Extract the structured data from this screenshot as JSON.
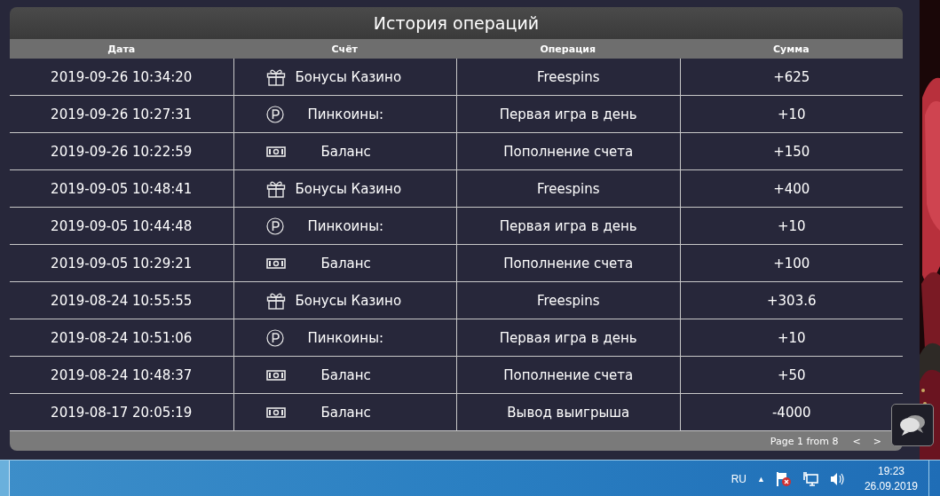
{
  "title": "История операций",
  "columns": [
    "Дата",
    "Счёт",
    "Операция",
    "Сумма"
  ],
  "rows": [
    {
      "date": "2019-09-26 10:34:20",
      "kind": "gift",
      "account": "Бонусы Казино",
      "operation": "Freespins",
      "amount": "+625"
    },
    {
      "date": "2019-09-26 10:27:31",
      "kind": "coin",
      "account": "Пинкоины:",
      "operation": "Первая игра в день",
      "amount": "+10"
    },
    {
      "date": "2019-09-26 10:22:59",
      "kind": "cash",
      "account": "Баланс",
      "operation": "Пополнение счета",
      "amount": "+150"
    },
    {
      "date": "2019-09-05 10:48:41",
      "kind": "gift",
      "account": "Бонусы Казино",
      "operation": "Freespins",
      "amount": "+400"
    },
    {
      "date": "2019-09-05 10:44:48",
      "kind": "coin",
      "account": "Пинкоины:",
      "operation": "Первая игра в день",
      "amount": "+10"
    },
    {
      "date": "2019-09-05 10:29:21",
      "kind": "cash",
      "account": "Баланс",
      "operation": "Пополнение счета",
      "amount": "+100"
    },
    {
      "date": "2019-08-24 10:55:55",
      "kind": "gift",
      "account": "Бонусы Казино",
      "operation": "Freespins",
      "amount": "+303.6"
    },
    {
      "date": "2019-08-24 10:51:06",
      "kind": "coin",
      "account": "Пинкоины:",
      "operation": "Первая игра в день",
      "amount": "+10"
    },
    {
      "date": "2019-08-24 10:48:37",
      "kind": "cash",
      "account": "Баланс",
      "operation": "Пополнение счета",
      "amount": "+50"
    },
    {
      "date": "2019-08-17 20:05:19",
      "kind": "cash",
      "account": "Баланс",
      "operation": "Вывод выигрыша",
      "amount": "-4000"
    }
  ],
  "pagination": {
    "text": "Page 1 from 8",
    "prev": "<",
    "next": ">"
  },
  "taskbar": {
    "language": "RU",
    "tray_arrow": "▲",
    "time": "19:23",
    "date": "26.09.2019"
  }
}
